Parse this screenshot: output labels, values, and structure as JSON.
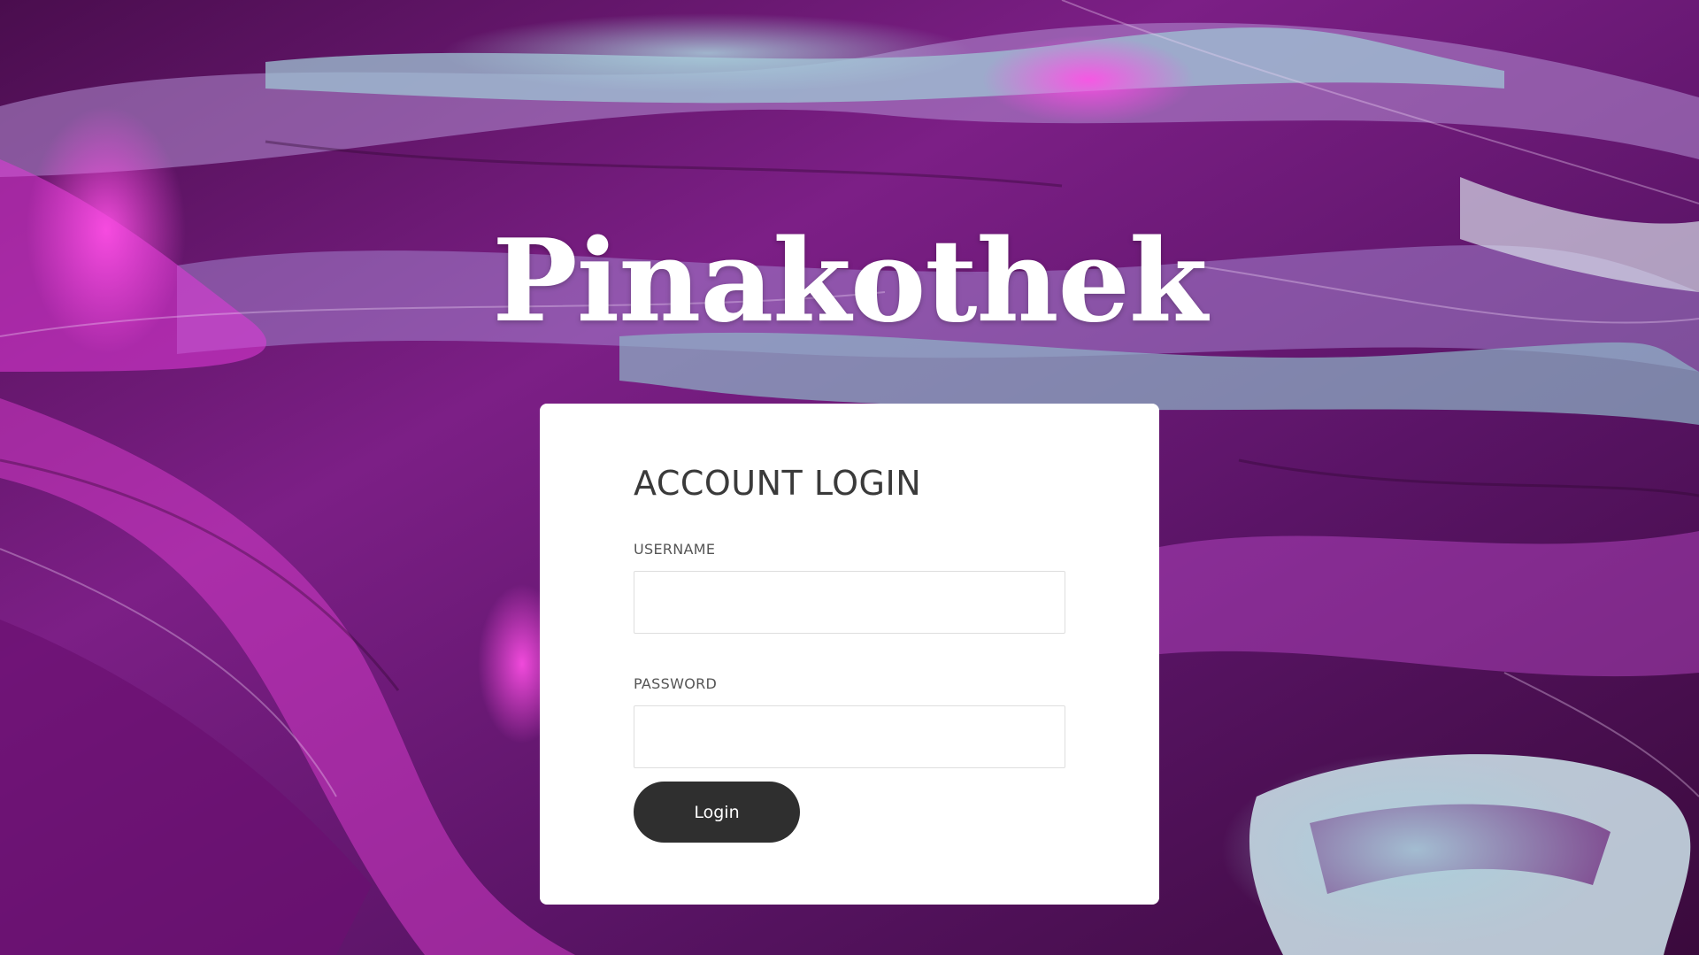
{
  "brand": {
    "title": "Pinakothek"
  },
  "login_card": {
    "heading": "ACCOUNT LOGIN",
    "username": {
      "label": "USERNAME",
      "value": "",
      "placeholder": ""
    },
    "password": {
      "label": "PASSWORD",
      "value": "",
      "placeholder": ""
    },
    "submit_label": "Login"
  },
  "colors": {
    "background_primary": "#8a1a8e",
    "background_highlight": "#e23ad8",
    "background_accent": "#8fb5c8",
    "card": "#ffffff",
    "button": "#2f2f2f",
    "heading_text": "#3a3a3a"
  }
}
